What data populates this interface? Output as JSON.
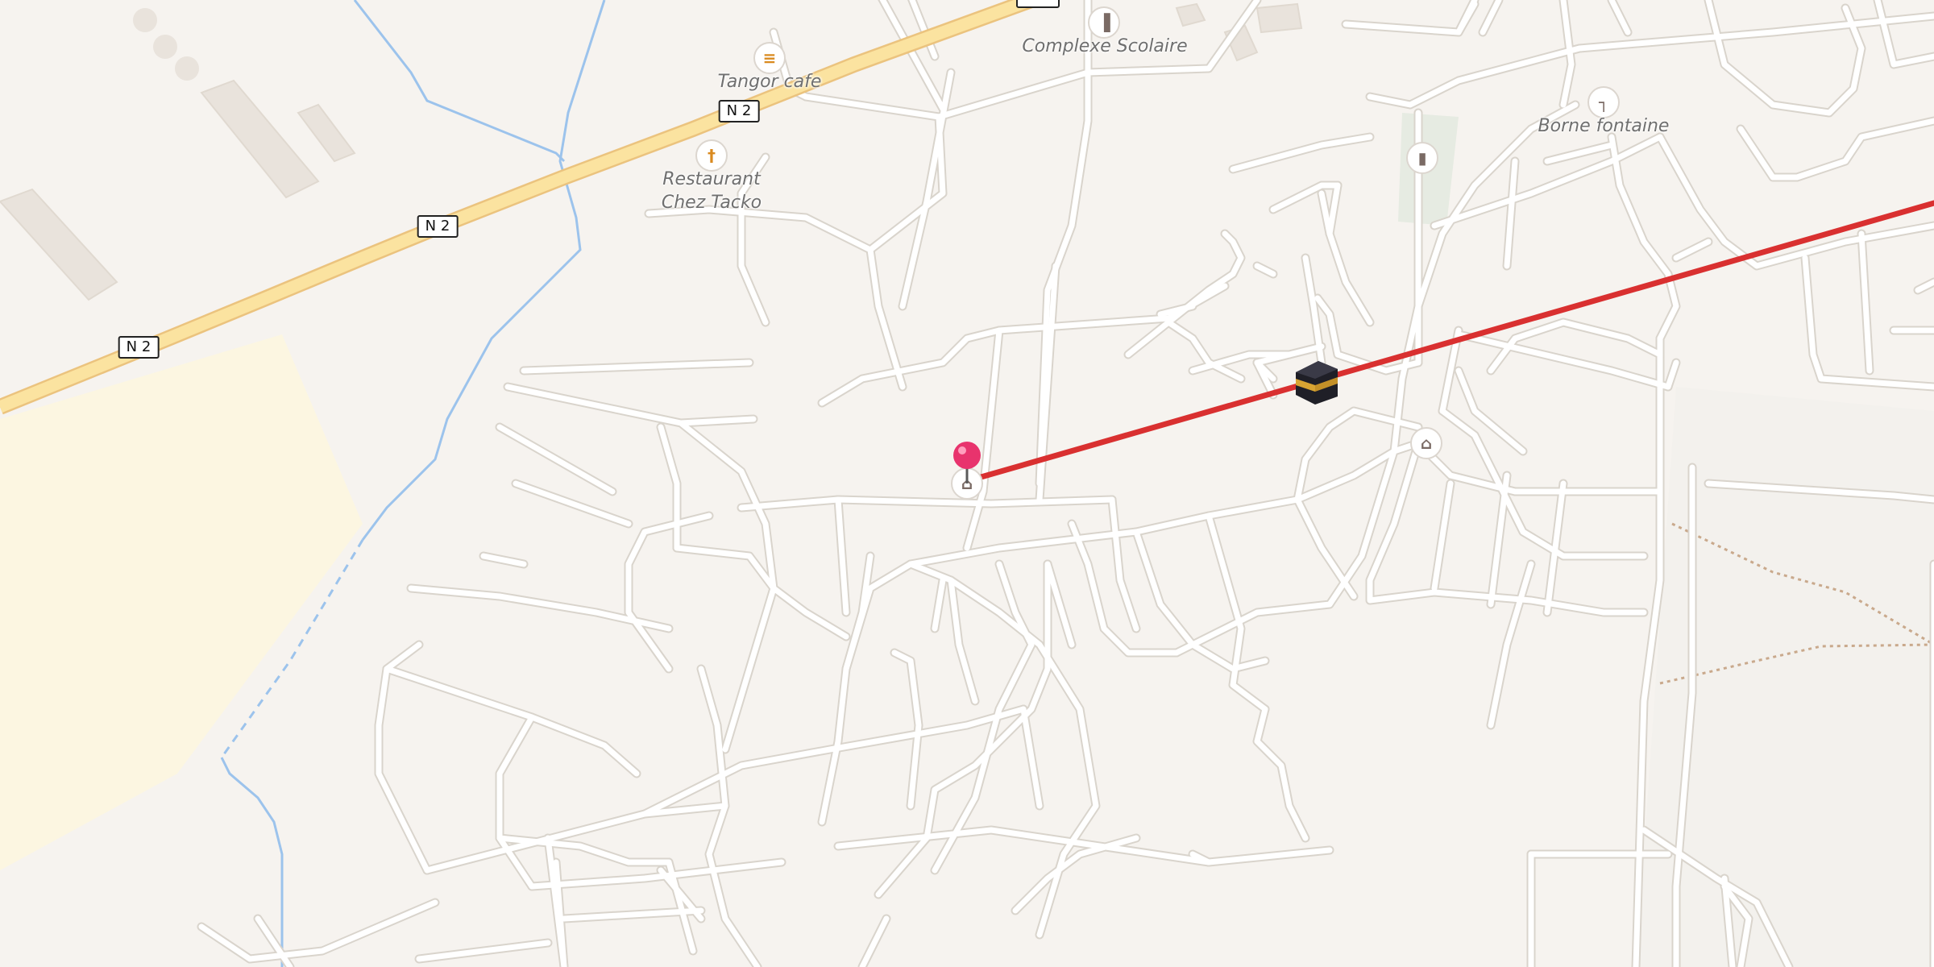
{
  "map": {
    "colors": {
      "background": "#f6f3ef",
      "street": "#ffffff",
      "street_casing": "#d9d4cc",
      "highway": "#fbe3a0",
      "highway_casing": "#ebc37e",
      "water": "#9cc3ec",
      "route": "#d93030",
      "marker": "#e8336d",
      "park": "#e6ebe2",
      "sand_area": "#fcf6e1",
      "poi_food": "#d98a1f",
      "poi_generic": "#7a6a64"
    },
    "road_shields": [
      "N 2",
      "N 2",
      "N 2",
      ""
    ],
    "pois": [
      {
        "name": "Tangor cafe",
        "icon": "burger-icon"
      },
      {
        "name": "Restaurant\nChez Tacko",
        "icon": "fork-knife-icon"
      },
      {
        "name": "Complexe Scolaire",
        "icon": "school-icon"
      },
      {
        "name": "Borne fontaine",
        "icon": "water-tap-icon"
      }
    ],
    "unlabeled_icons": [
      "waste-basket-icon",
      "mosque-icon",
      "mosque-icon"
    ],
    "destination": {
      "icon": "kaaba-icon"
    },
    "location_marker": {
      "icon": "location-pin-icon"
    }
  }
}
